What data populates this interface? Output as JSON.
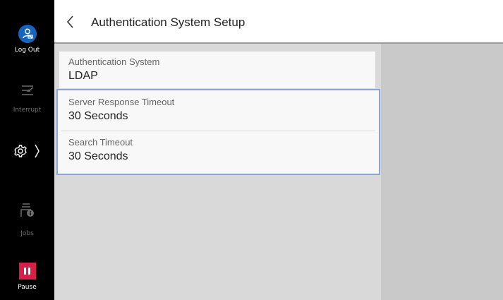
{
  "sidebar": {
    "logout_label": "Log Out",
    "interrupt_label": "Interrupt",
    "jobs_label": "Jobs",
    "pause_label": "Pause",
    "accent_color": "#1565c0",
    "pause_color": "#d71f4a"
  },
  "header": {
    "title": "Authentication System Setup"
  },
  "settings": [
    {
      "label": "Authentication System",
      "value": "LDAP"
    },
    {
      "label": "Server Response Timeout",
      "value": "30 Seconds"
    },
    {
      "label": "Search Timeout",
      "value": "30 Seconds"
    }
  ],
  "selection_color": "#8aa6d7"
}
